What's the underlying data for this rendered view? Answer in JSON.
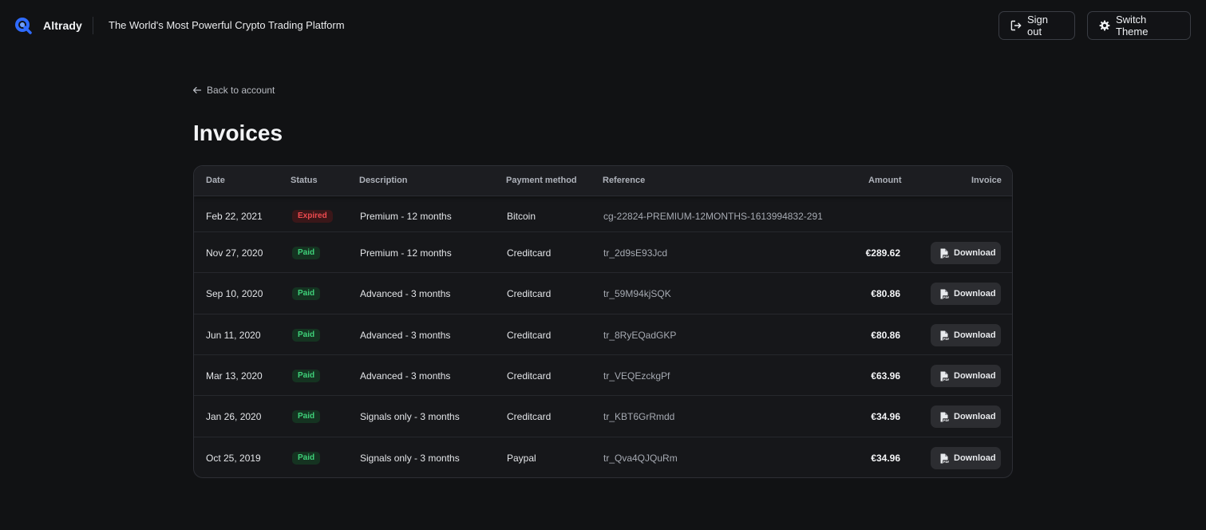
{
  "header": {
    "brand": "Altrady",
    "tagline": "The World's Most Powerful Crypto Trading Platform",
    "sign_out_label": "Sign out",
    "switch_theme_label": "Switch Theme"
  },
  "nav": {
    "back_label": "Back to account"
  },
  "page": {
    "title": "Invoices"
  },
  "table": {
    "columns": [
      "Date",
      "Status",
      "Description",
      "Payment method",
      "Reference",
      "Amount",
      "Invoice"
    ],
    "download_label": "Download",
    "rows": [
      {
        "date": "Feb 22, 2021",
        "status": "Expired",
        "description": "Premium - 12 months",
        "method": "Bitcoin",
        "reference": "cg-22824-PREMIUM-12MONTHS-1613994832-291",
        "amount": ""
      },
      {
        "date": "Nov 27, 2020",
        "status": "Paid",
        "description": "Premium - 12 months",
        "method": "Creditcard",
        "reference": "tr_2d9sE93Jcd",
        "amount": "€289.62"
      },
      {
        "date": "Sep 10, 2020",
        "status": "Paid",
        "description": "Advanced - 3 months",
        "method": "Creditcard",
        "reference": "tr_59M94kjSQK",
        "amount": "€80.86"
      },
      {
        "date": "Jun 11, 2020",
        "status": "Paid",
        "description": "Advanced - 3 months",
        "method": "Creditcard",
        "reference": "tr_8RyEQadGKP",
        "amount": "€80.86"
      },
      {
        "date": "Mar 13, 2020",
        "status": "Paid",
        "description": "Advanced - 3 months",
        "method": "Creditcard",
        "reference": "tr_VEQEzckgPf",
        "amount": "€63.96"
      },
      {
        "date": "Jan 26, 2020",
        "status": "Paid",
        "description": "Signals only - 3 months",
        "method": "Creditcard",
        "reference": "tr_KBT6GrRmdd",
        "amount": "€34.96"
      },
      {
        "date": "Oct 25, 2019",
        "status": "Paid",
        "description": "Signals only - 3 months",
        "method": "Paypal",
        "reference": "tr_Qva4QJQuRm",
        "amount": "€34.96"
      }
    ]
  },
  "colors": {
    "paid": "#3fd27a",
    "expired": "#ef4a4f",
    "brand": "#2f6bff"
  },
  "icons": {
    "logo": "altrady-logo-icon",
    "sign_out": "sign-out-icon",
    "theme": "gear-icon",
    "back": "arrow-left-icon",
    "download": "pdf-file-icon"
  }
}
